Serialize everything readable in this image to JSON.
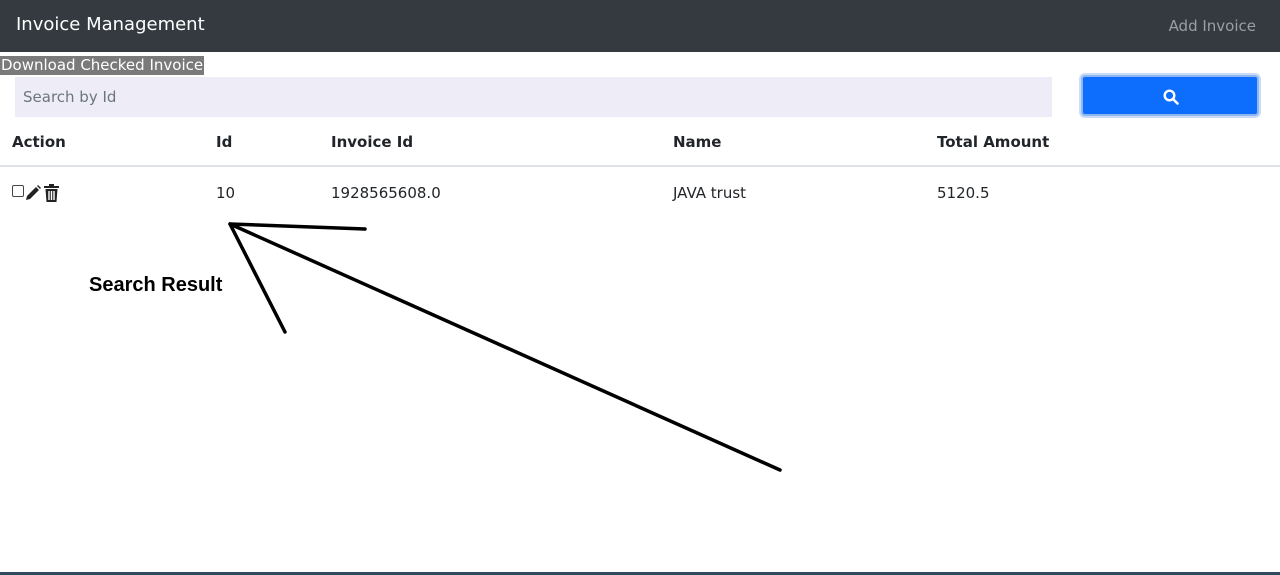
{
  "navbar": {
    "brand": "Invoice Management",
    "add_invoice": "Add Invoice"
  },
  "toolbar": {
    "download_label": "Download Checked Invoice",
    "search_placeholder": "Search by Id",
    "search_icon": "search-icon"
  },
  "table": {
    "headers": [
      "Action",
      "Id",
      "Invoice Id",
      "Name",
      "Total Amount"
    ],
    "rows": [
      {
        "checked": false,
        "id": "10",
        "invoice_id": "1928565608.0",
        "name": "JAVA trust",
        "total_amount": "5120.5"
      }
    ]
  },
  "annotation": {
    "text": "Search Result"
  },
  "colors": {
    "navbar": "#343a40",
    "primary": "#0d6efd",
    "search_bg": "#eeedf7"
  }
}
